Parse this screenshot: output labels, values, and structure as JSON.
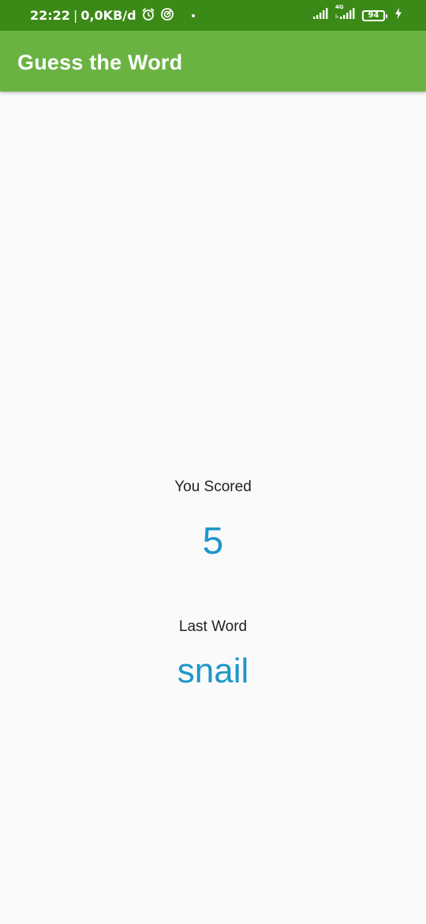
{
  "status_bar": {
    "time": "22:22",
    "data_rate": "0,0KB/d",
    "network_type": "4G",
    "battery_level": "94",
    "icons": [
      "alarm-icon",
      "vpn-icon",
      "signal-icon",
      "signal-4g-icon",
      "battery-icon",
      "charging-icon"
    ],
    "background_color": "#3b8a17"
  },
  "app_bar": {
    "title": "Guess the Word",
    "background_color": "#6ab343"
  },
  "score": {
    "label": "You Scored",
    "value": "5"
  },
  "last_word": {
    "label": "Last Word",
    "value": "snail"
  },
  "colors": {
    "accent": "#1e96c8",
    "label_text": "#222222",
    "background": "#fafafa"
  }
}
